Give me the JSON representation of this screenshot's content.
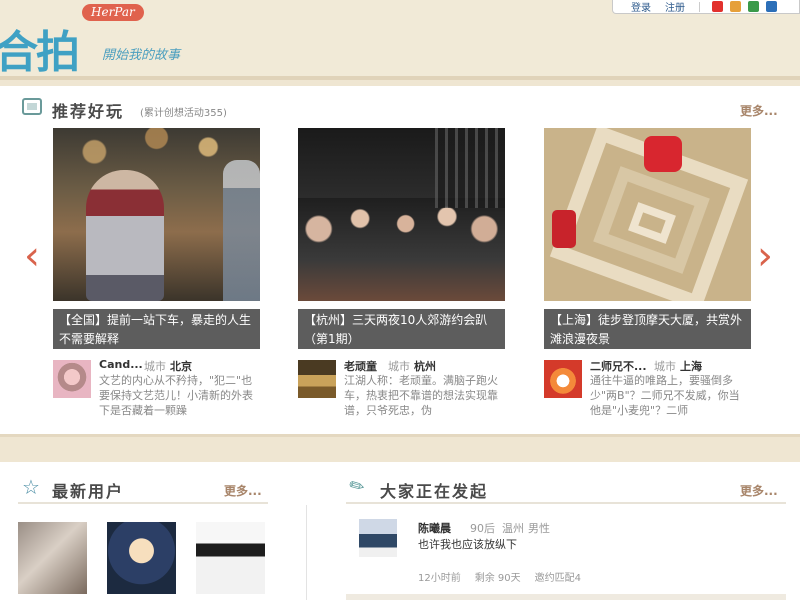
{
  "header": {
    "logo_text": "合拍",
    "logo_badge": "HerPar",
    "tagline": "開始我的故事"
  },
  "topbar": {
    "login": "登录",
    "register": "注册",
    "social_icons": [
      "weibo-icon",
      "tencent-weibo-icon",
      "renren-icon",
      "qzone-icon"
    ]
  },
  "recommend": {
    "icon": "tv-icon",
    "title": "推荐好玩",
    "subtitle": "(累计创想活动355)",
    "more": "更多...",
    "prev_arrow": "‹",
    "next_arrow": "›",
    "cards": [
      {
        "caption": "【全国】提前一站下车，暴走的人生不需要解释",
        "user": "Cand...",
        "city_label": "城市",
        "city": "北京",
        "desc": "文艺的内心从不矜持，\"犯二\"也要保持文艺范儿！小清新的外表下是否藏着一颗躁"
      },
      {
        "caption": "【杭州】三天两夜10人郊游约会趴（第1期）",
        "user": "老顽童",
        "city_label": "城市",
        "city": "杭州",
        "desc": "江湖人称：老顽童。满脑子跑火车，热衷把不靠谱的想法实现靠谱，只爷死忠，伪"
      },
      {
        "caption": "【上海】徒步登顶摩天大厦，共赏外滩浪漫夜景",
        "user": "二师兄不...",
        "city_label": "城市",
        "city": "上海",
        "desc": "通往牛逼的唯路上，要骚倒多少\"两B\"？二师兄不发威，你当他是\"小麦兜\"？二师"
      }
    ]
  },
  "new_users": {
    "icon": "star-icon",
    "title": "最新用户",
    "more": "更多..."
  },
  "activities": {
    "icon": "feather-icon",
    "title": "大家正在发起",
    "more": "更多...",
    "item": {
      "name": "陈曦晨",
      "age": "90后",
      "city": "温州",
      "gender": "男性",
      "text": "也许我也应该放纵下",
      "time": "12小时前",
      "remaining": "剩余 90天",
      "invite": "邀约匹配4"
    }
  },
  "colors": {
    "accent_orange": "#d9634c",
    "logo_blue": "#3fa1c4",
    "more_brown": "#a8856a",
    "background": "#efe6d2"
  }
}
